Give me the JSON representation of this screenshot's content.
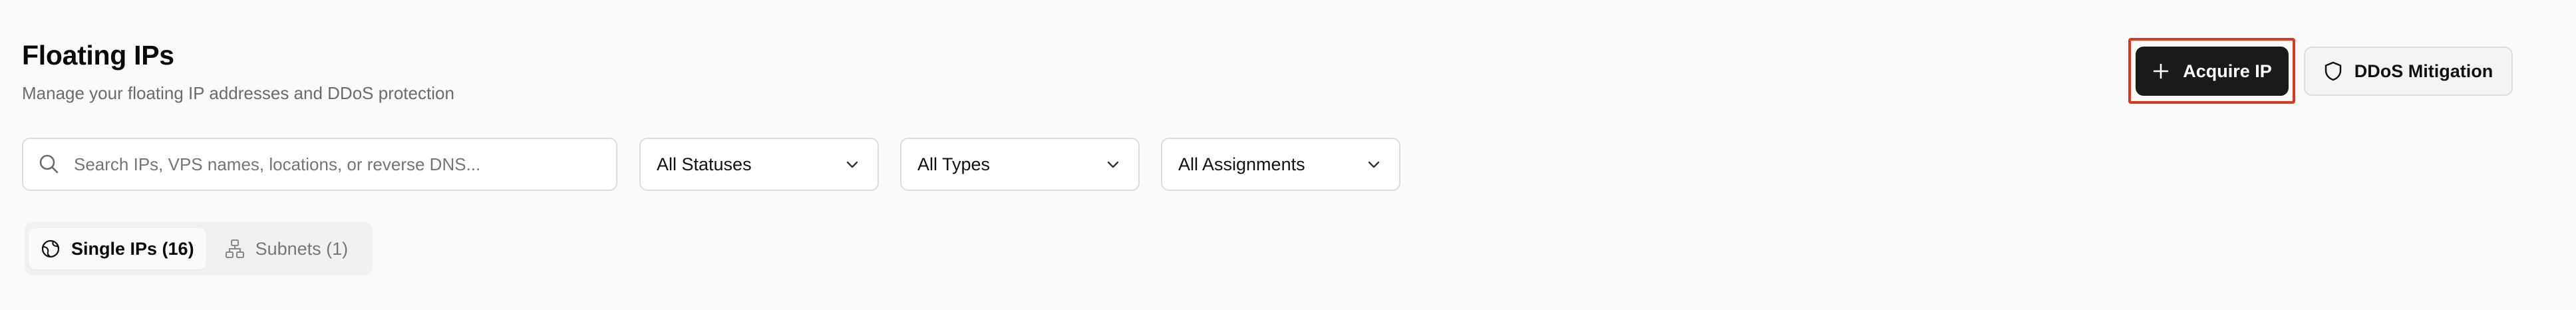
{
  "header": {
    "title": "Floating IPs",
    "subtitle": "Manage your floating IP addresses and DDoS protection"
  },
  "actions": {
    "acquire_label": "Acquire IP",
    "ddos_label": "DDoS Mitigation",
    "acquire_icon": "plus-icon",
    "ddos_icon": "shield-icon"
  },
  "filters": {
    "search_placeholder": "Search IPs, VPS names, locations, or reverse DNS...",
    "search_value": "",
    "status_selected": "All Statuses",
    "type_selected": "All Types",
    "assignment_selected": "All Assignments"
  },
  "tabs": [
    {
      "label": "Single IPs (16)",
      "icon": "globe-icon",
      "active": true
    },
    {
      "label": "Subnets (1)",
      "icon": "network-icon",
      "active": false
    }
  ],
  "colors": {
    "background": "#fafafa",
    "primary_button": "#1a1a1a",
    "focus_outline": "#d9391f",
    "muted_text": "#6b6b6b"
  }
}
